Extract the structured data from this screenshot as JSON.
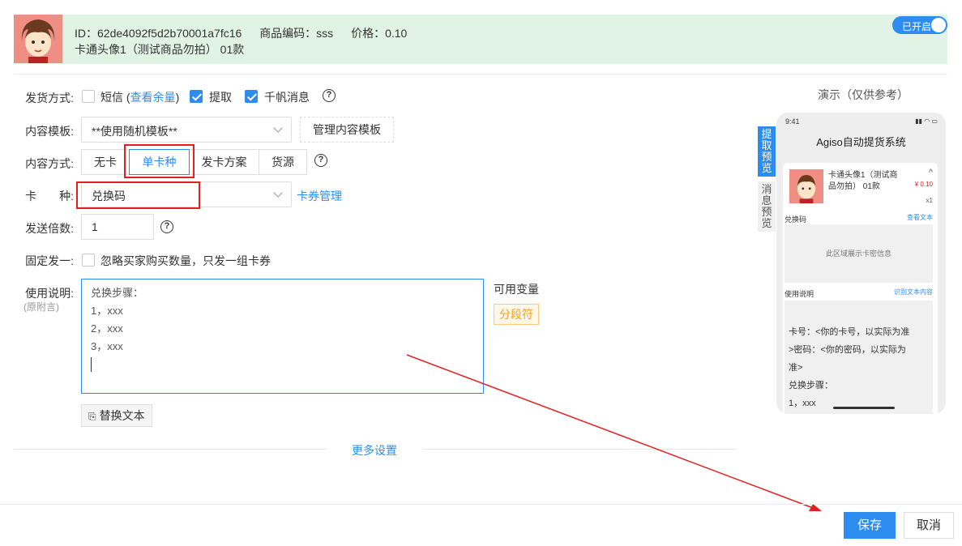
{
  "header": {
    "id_text": "ID：62de4092f5d2b70001a7fc16",
    "code_text": "商品编码：sss",
    "price_text": "价格：0.10",
    "product_name": "卡通头像1（测试商品勿拍） 01款",
    "toggle_label": "已开启",
    "toggle_on": true
  },
  "form": {
    "delivery": {
      "label": "发货方式:",
      "sms_label": "短信",
      "sms_paren_open": "(",
      "sms_link": "查看余量",
      "sms_paren_close": ")",
      "sms_checked": false,
      "pickup_label": "提取",
      "pickup_checked": true,
      "qianfan_label": "千帆消息",
      "qianfan_checked": true,
      "help": "?"
    },
    "template": {
      "label": "内容模板:",
      "value": "**使用随机模板**",
      "manage_button": "管理内容模板"
    },
    "content_mode": {
      "label": "内容方式:",
      "options": [
        "无卡",
        "单卡种",
        "发卡方案",
        "货源"
      ],
      "selected": "单卡种",
      "help": "?"
    },
    "card_type": {
      "label": "卡　　种:",
      "value": "兑换码",
      "manage_link": "卡券管理"
    },
    "multiplier": {
      "label": "发送倍数:",
      "value": "1",
      "help": "?"
    },
    "fixed_one": {
      "label": "固定发一:",
      "checkbox_label": "忽略买家购买数量，只发一组卡券",
      "checked": false
    },
    "instructions": {
      "label": "使用说明:",
      "sublabel": "(原附言)",
      "lines": [
        "兑换步骤：",
        "1，xxx",
        "2，xxx",
        "3，xxx"
      ],
      "variables_title": "可用变量",
      "variable_tag": "分段符",
      "replace_button": "替换文本"
    },
    "more_settings": "更多设置"
  },
  "preview": {
    "title": "演示（仅供参考）",
    "tab_pickup": "提取预览",
    "tab_message": "消息预览",
    "phone": {
      "time": "9:41",
      "app_title": "Agiso自动提货系统",
      "product_name": "卡通头像1（测试商品勿拍） 01款",
      "price": "¥ 0.10",
      "qty": "x1",
      "code_label": "兑换码",
      "view_text_link": "查看文本",
      "placeholder": "此区域展示卡密信息",
      "usage_label": "使用说明",
      "recognize_link": "识别文本内容",
      "usage_lines": [
        "卡号：<你的卡号，以实际为准",
        ">密码：<你的密码，以实际为",
        "准>",
        "兑换步骤：",
        "1，xxx"
      ]
    }
  },
  "footer": {
    "save": "保存",
    "cancel": "取消"
  },
  "colors": {
    "accent": "#2d8cf0",
    "header_bg": "#e1f3e4",
    "highlight": "#e02020",
    "price": "#e02020"
  }
}
